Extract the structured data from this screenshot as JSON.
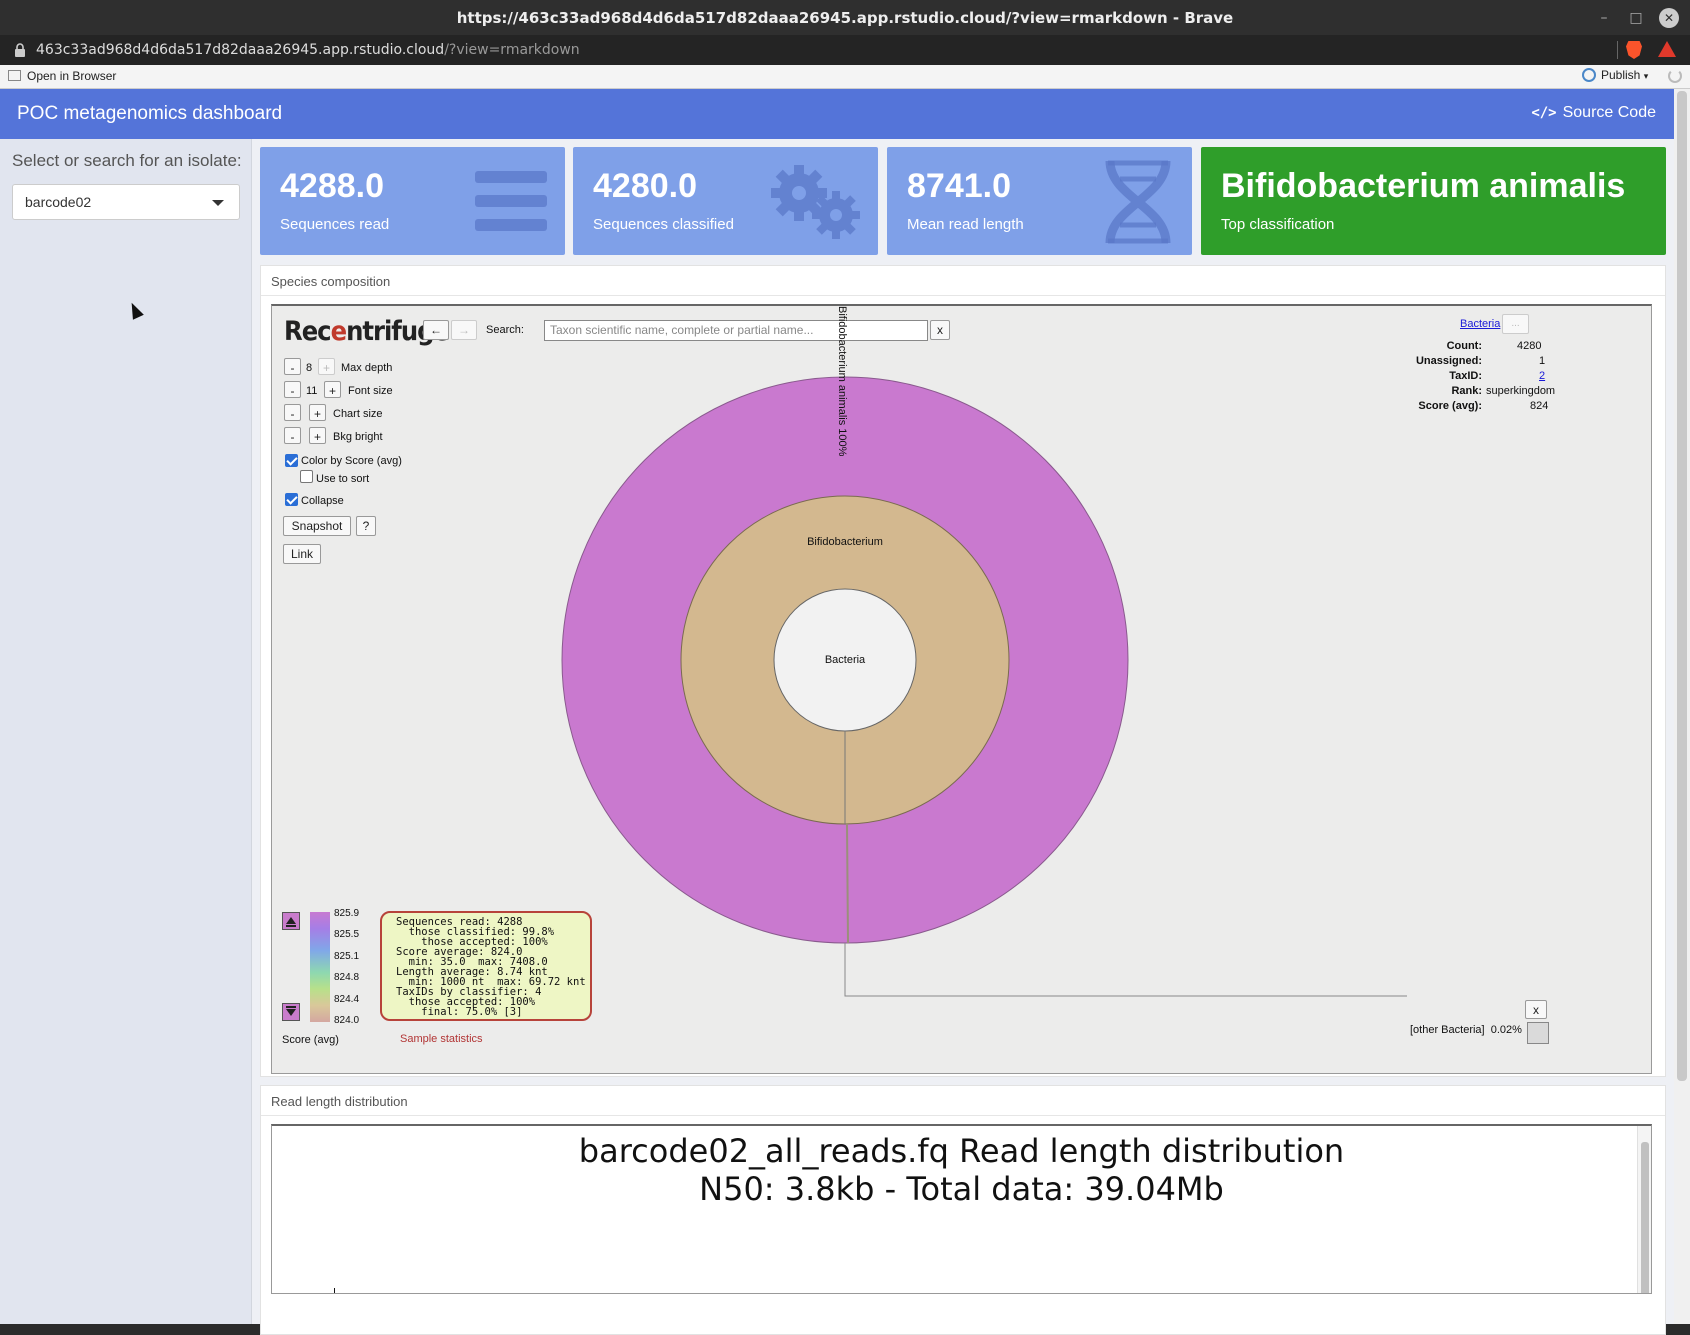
{
  "window": {
    "title": "https://463c33ad968d4d6da517d82daaa26945.app.rstudio.cloud/?view=rmarkdown - Brave",
    "url_host": "463c33ad968d4d6da517d82daaa26945.app.rstudio.cloud",
    "url_path": "/?view=rmarkdown"
  },
  "rstudio_bar": {
    "open_in_browser": "Open in Browser",
    "publish": "Publish"
  },
  "navbar": {
    "brand": "POC metagenomics dashboard",
    "source_code": "Source Code"
  },
  "sidebar": {
    "label": "Select or search for an isolate:",
    "selected": "barcode02"
  },
  "value_boxes": [
    {
      "value": "4288.0",
      "caption": "Sequences read",
      "icon": "bars-icon"
    },
    {
      "value": "4280.0",
      "caption": "Sequences classified",
      "icon": "gears-icon"
    },
    {
      "value": "8741.0",
      "caption": "Mean read length",
      "icon": "dna-icon"
    },
    {
      "value": "Bifidobacterium animalis",
      "caption": "Top classification"
    }
  ],
  "species_card": {
    "header": "Species composition",
    "logo": {
      "prefix": "Rec",
      "o": "e",
      "suffix": "ntrifuge"
    },
    "nav": {
      "back": "←",
      "forward": "→"
    },
    "search_label": "Search:",
    "search_placeholder": "Taxon scientific name, complete or partial name...",
    "search_clear": "x",
    "controls": {
      "max_depth": {
        "value": "8",
        "label": "Max depth"
      },
      "font_size": {
        "value": "11",
        "label": "Font size"
      },
      "chart_size": {
        "label": "Chart size"
      },
      "bkg_bright": {
        "label": "Bkg bright"
      },
      "minus": "-",
      "plus": "+",
      "color_by": "Color by Score (avg)",
      "use_to_sort": "Use to sort",
      "collapse": "Collapse",
      "snapshot": "Snapshot",
      "help": "?",
      "link": "Link"
    },
    "info": {
      "taxon": "Bacteria",
      "more": "...",
      "count_label": "Count:",
      "count": "4280",
      "unassigned_label": "Unassigned:",
      "unassigned": "1",
      "taxid_label": "TaxID:",
      "taxid": "2",
      "rank_label": "Rank:",
      "rank": "superkingdom",
      "score_label": "Score (avg):",
      "score": "824"
    },
    "sunburst": {
      "center": "Bacteria",
      "ring1": "Bifidobacterium",
      "ring2_label": "Bifidobacterium animalis  100%",
      "colors": {
        "center": "#f2f2f2",
        "ring1": "#d3b88f",
        "ring2": "#c979cf"
      }
    },
    "score_scale": {
      "ticks": [
        "825.9",
        "825.5",
        "825.1",
        "824.8",
        "824.4",
        "824.0"
      ],
      "label": "Score (avg)"
    },
    "tooltip": "Sequences read: 4288\n  those classified: 99.8%\n    those accepted: 100%\nScore average: 824.0\n  min: 35.0  max: 7408.0\nLength average: 8.74 knt\n  min: 1000 nt  max: 69.72 knt\nTaxIDs by classifier: 4\n  those accepted: 100%\n    final: 75.0% [3]",
    "sample_stats": "Sample statistics",
    "other": {
      "label": "[other Bacteria]",
      "pct": "0.02%",
      "close": "x"
    }
  },
  "readlen_card": {
    "header": "Read length distribution",
    "title_line1": "barcode02_all_reads.fq Read length distribution",
    "title_line2": "N50: 3.8kb - Total data: 39.04Mb"
  }
}
